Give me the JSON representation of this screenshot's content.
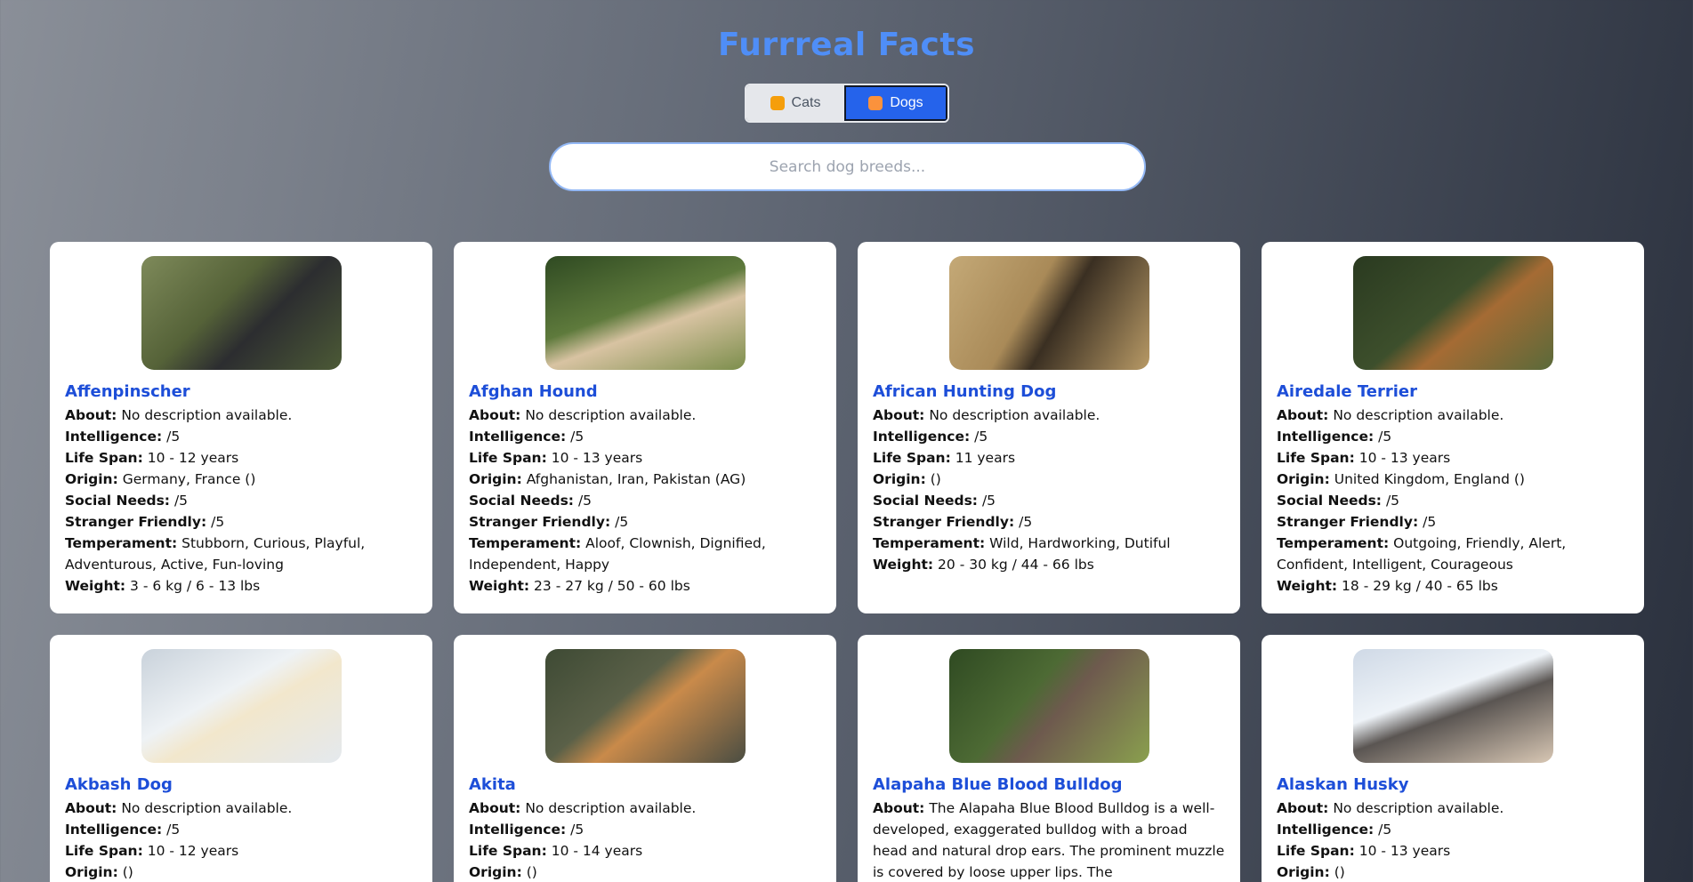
{
  "app": {
    "title": "Furrreal Facts"
  },
  "toggle": {
    "cats_label": "Cats",
    "dogs_label": "Dogs",
    "active": "Dogs"
  },
  "search": {
    "placeholder": "Search dog breeds...",
    "value": ""
  },
  "field_labels": {
    "about": "About:",
    "intelligence": "Intelligence:",
    "life_span": "Life Span:",
    "origin": "Origin:",
    "social_needs": "Social Needs:",
    "stranger_friendly": "Stranger Friendly:",
    "temperament": "Temperament:",
    "weight": "Weight:"
  },
  "breeds": [
    {
      "name": "Affenpinscher",
      "about": "No description available.",
      "intelligence": "/5",
      "life_span": "10 - 12 years",
      "origin": "Germany, France ()",
      "social_needs": "/5",
      "stranger_friendly": "/5",
      "temperament": "Stubborn, Curious, Playful, Adventurous, Active, Fun-loving",
      "weight": "3 - 6 kg / 6 - 13 lbs",
      "image_colors": [
        "#6b7a4f",
        "#2f3033"
      ]
    },
    {
      "name": "Afghan Hound",
      "about": "No description available.",
      "intelligence": "/5",
      "life_span": "10 - 13 years",
      "origin": "Afghanistan, Iran, Pakistan (AG)",
      "social_needs": "/5",
      "stranger_friendly": "/5",
      "temperament": "Aloof, Clownish, Dignified, Independent, Happy",
      "weight": "23 - 27 kg / 50 - 60 lbs",
      "image_colors": [
        "#3f5e2c",
        "#d9c3a5"
      ]
    },
    {
      "name": "African Hunting Dog",
      "about": "No description available.",
      "intelligence": "/5",
      "life_span": "11 years",
      "origin": "()",
      "social_needs": "/5",
      "stranger_friendly": "/5",
      "temperament": "Wild, Hardworking, Dutiful",
      "weight": "20 - 30 kg / 44 - 66 lbs",
      "image_colors": [
        "#b69a6a",
        "#3a2f22"
      ]
    },
    {
      "name": "Airedale Terrier",
      "about": "No description available.",
      "intelligence": "/5",
      "life_span": "10 - 13 years",
      "origin": "United Kingdom, England ()",
      "social_needs": "/5",
      "stranger_friendly": "/5",
      "temperament": "Outgoing, Friendly, Alert, Confident, Intelligent, Courageous",
      "weight": "18 - 29 kg / 40 - 65 lbs",
      "image_colors": [
        "#2f3d22",
        "#a56b34"
      ]
    },
    {
      "name": "Akbash Dog",
      "about": "No description available.",
      "intelligence": "/5",
      "life_span": "10 - 12 years",
      "origin": "()",
      "image_colors": [
        "#e8edf1",
        "#f2e7cc"
      ]
    },
    {
      "name": "Akita",
      "about": "No description available.",
      "intelligence": "/5",
      "life_span": "10 - 14 years",
      "origin": "()",
      "image_colors": [
        "#4b4f3e",
        "#c98a4a"
      ]
    },
    {
      "name": "Alapaha Blue Blood Bulldog",
      "about": "The Alapaha Blue Blood Bulldog is a well-developed, exaggerated bulldog with a broad head and natural drop ears. The prominent muzzle is covered by loose upper lips. The",
      "image_colors": [
        "#3f5a2d",
        "#6e5a4e"
      ]
    },
    {
      "name": "Alaskan Husky",
      "about": "No description available.",
      "intelligence": "/5",
      "life_span": "10 - 13 years",
      "origin": "()",
      "image_colors": [
        "#dfe8f2",
        "#5a5552"
      ]
    }
  ]
}
